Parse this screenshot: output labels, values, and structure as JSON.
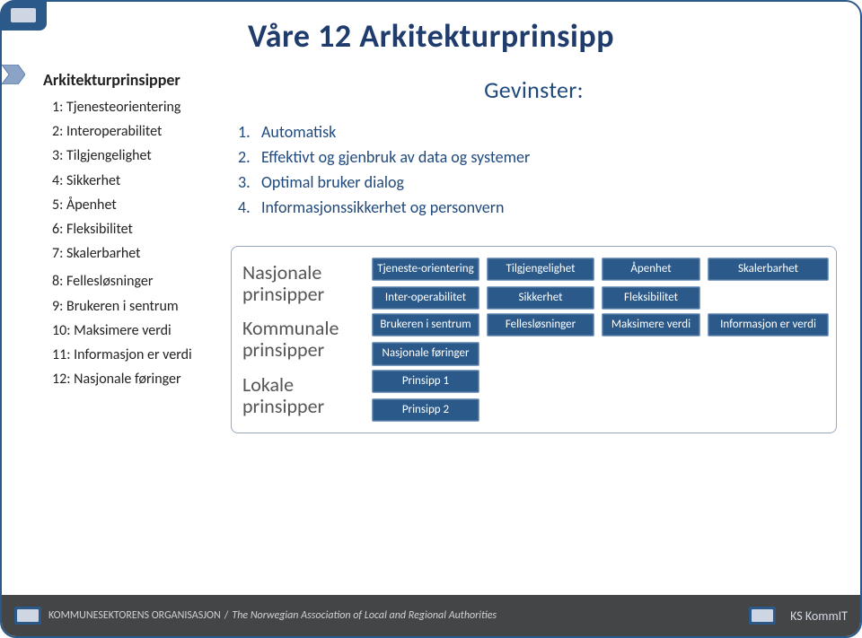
{
  "title": "Våre 12 Arkitekturprinsipp",
  "left": {
    "heading": "Arkitekturprinsipper",
    "items": [
      "1: Tjenesteorientering",
      "2: Interoperabilitet",
      "3: Tilgjengelighet",
      "4: Sikkerhet",
      "5: Åpenhet",
      "6: Fleksibilitet",
      "7: Skalerbarhet",
      "8: Fellesløsninger",
      "9: Brukeren i sentrum",
      "10: Maksimere verdi",
      "11: Informasjon er verdi",
      "12: Nasjonale føringer"
    ]
  },
  "gevinster": {
    "title": "Gevinster:",
    "items": [
      {
        "num": "1.",
        "text": "Automatisk"
      },
      {
        "num": "2.",
        "text": "Effektivt og gjenbruk av data og systemer"
      },
      {
        "num": "3.",
        "text": "Optimal bruker dialog"
      },
      {
        "num": "4.",
        "text": "Informasjonssikkerhet og personvern"
      }
    ]
  },
  "matrix": {
    "rows": [
      {
        "label": "Nasjonale prinsipper",
        "cells_row1": [
          "Tjeneste-orientering",
          "Tilgjengelighet",
          "Åpenhet",
          "Skalerbarhet"
        ],
        "cells_row2": [
          "Inter-operabilitet",
          "Sikkerhet",
          "Fleksibilitet",
          ""
        ]
      },
      {
        "label": "Kommunale prinsipper",
        "cells_row1": [
          "Brukeren i sentrum",
          "Fellesløsninger",
          "Maksimere verdi",
          "Informasjon er verdi"
        ],
        "cells_row2": [
          "Nasjonale føringer",
          "",
          "",
          ""
        ]
      },
      {
        "label": "Lokale prinsipper",
        "cells_row1": [
          "Prinsipp 1"
        ],
        "cells_row2": [
          "Prinsipp 2"
        ]
      }
    ]
  },
  "footer": {
    "org": "KOMMUNESEKTORENS ORGANISASJON",
    "org_en": "The Norwegian Association of Local and Regional Authorities",
    "brand": "KS KommIT"
  }
}
